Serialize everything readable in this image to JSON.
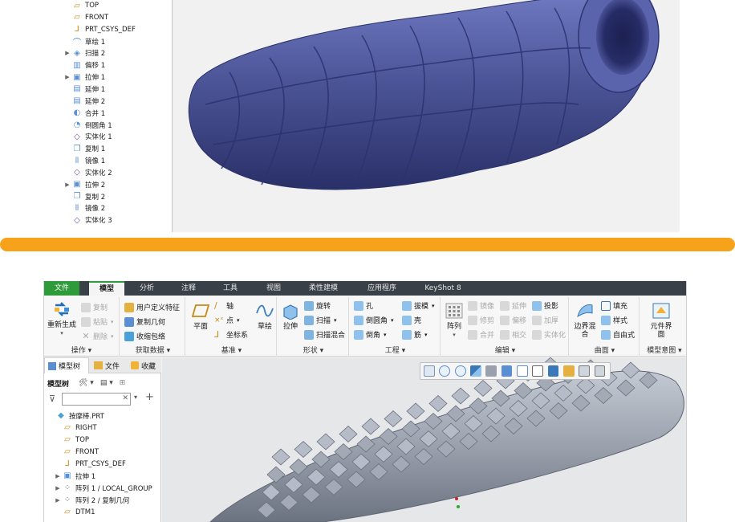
{
  "top_tree": {
    "items": [
      {
        "label": "TOP",
        "icon": "datum-plane-icon",
        "expand": false
      },
      {
        "label": "FRONT",
        "icon": "datum-plane-icon",
        "expand": false
      },
      {
        "label": "PRT_CSYS_DEF",
        "icon": "csys-icon",
        "expand": false
      },
      {
        "label": "草绘 1",
        "icon": "sketch-icon",
        "expand": false
      },
      {
        "label": "扫描 2",
        "icon": "sweep-icon",
        "expand": true
      },
      {
        "label": "偏移 1",
        "icon": "offset-icon",
        "expand": false
      },
      {
        "label": "拉伸 1",
        "icon": "extrude-icon",
        "expand": true
      },
      {
        "label": "延伸 1",
        "icon": "extend-icon",
        "expand": false
      },
      {
        "label": "延伸 2",
        "icon": "extend-icon",
        "expand": false
      },
      {
        "label": "合并 1",
        "icon": "merge-icon",
        "expand": false
      },
      {
        "label": "倒圆角 1",
        "icon": "round-icon",
        "expand": false
      },
      {
        "label": "实体化 1",
        "icon": "solidify-icon",
        "expand": false
      },
      {
        "label": "复制 1",
        "icon": "copy-icon",
        "expand": false
      },
      {
        "label": "镜像 1",
        "icon": "mirror-icon",
        "expand": false
      },
      {
        "label": "实体化 2",
        "icon": "solidify-icon",
        "expand": false
      },
      {
        "label": "拉伸 2",
        "icon": "extrude-icon",
        "expand": true
      },
      {
        "label": "复制 2",
        "icon": "copy-icon",
        "expand": false
      },
      {
        "label": "镜像 2",
        "icon": "mirror-icon",
        "expand": false
      },
      {
        "label": "实体化 3",
        "icon": "solidify-icon",
        "expand": false
      }
    ]
  },
  "menubar": {
    "items": [
      "文件",
      "模型",
      "分析",
      "注释",
      "工具",
      "视图",
      "柔性建模",
      "应用程序",
      "KeyShot 8"
    ]
  },
  "ribbon": {
    "operations": {
      "label": "操作",
      "regen": "重新生成",
      "copy": "复制",
      "paste": "粘贴",
      "delete": "删除"
    },
    "get_data": {
      "label": "获取数据",
      "udf": "用户定义特征",
      "copy_geom": "复制几何",
      "shrinkwrap": "收缩包络"
    },
    "datum": {
      "label": "基准",
      "plane": "平面",
      "axis": "轴",
      "point": "点",
      "csys": "坐标系",
      "sketch": "草绘"
    },
    "shapes": {
      "label": "形状",
      "extrude": "拉伸",
      "revolve": "旋转",
      "sweep": "扫描",
      "swept_blend": "扫描混合"
    },
    "engineering": {
      "label": "工程",
      "hole": "孔",
      "round": "倒圆角",
      "chamfer": "倒角",
      "draft": "拔模",
      "shell": "壳",
      "rib": "筋"
    },
    "editing": {
      "label": "编辑",
      "pattern": "阵列",
      "mirror": "镜像",
      "trim": "修剪",
      "merge": "合并",
      "extend": "延伸",
      "offset": "偏移",
      "intersect": "相交",
      "project": "投影",
      "thicken": "加厚",
      "solidify": "实体化"
    },
    "surfaces": {
      "label": "曲面",
      "boundary_blend": "边界混合",
      "fill": "填充",
      "style": "样式",
      "freestyle": "自由式"
    },
    "model_intent": {
      "label": "模型意图",
      "component_interface": "元件界面"
    }
  },
  "navpanel": {
    "tabs": [
      "模型树",
      "文件",
      "收藏"
    ],
    "header": "模型树",
    "search_value": "",
    "items": [
      {
        "label": "按摩棒.PRT",
        "icon": "part-icon",
        "expand": false,
        "indent": 0
      },
      {
        "label": "RIGHT",
        "icon": "datum-plane-icon",
        "expand": false,
        "indent": 1
      },
      {
        "label": "TOP",
        "icon": "datum-plane-icon",
        "expand": false,
        "indent": 1
      },
      {
        "label": "FRONT",
        "icon": "datum-plane-icon",
        "expand": false,
        "indent": 1
      },
      {
        "label": "PRT_CSYS_DEF",
        "icon": "csys-icon",
        "expand": false,
        "indent": 1
      },
      {
        "label": "拉伸 1",
        "icon": "extrude-icon",
        "expand": true,
        "indent": 1
      },
      {
        "label": "阵列 1 / LOCAL_GROUP",
        "icon": "pattern-icon",
        "expand": true,
        "indent": 1
      },
      {
        "label": "阵列 2 / 复制几何",
        "icon": "pattern-icon",
        "expand": true,
        "indent": 1
      },
      {
        "label": "DTM1",
        "icon": "datum-plane-icon",
        "expand": false,
        "indent": 1
      }
    ]
  },
  "colors": {
    "accent_green": "#2e9a3a",
    "divider_orange": "#f7a21b",
    "model_blue": "#4b5496",
    "model_gray": "#9aa1ad"
  }
}
